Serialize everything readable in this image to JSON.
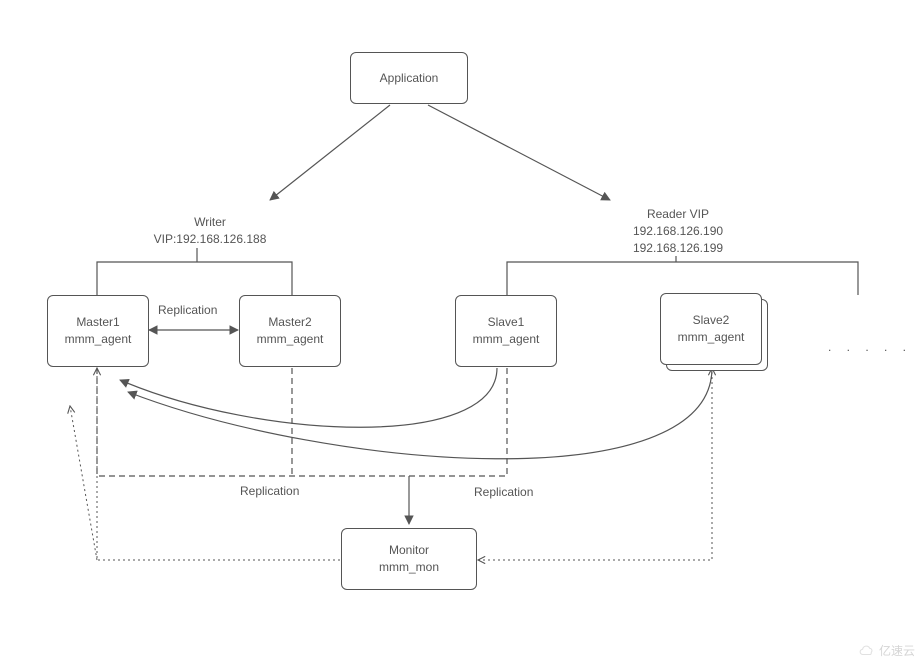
{
  "nodes": {
    "application": {
      "title": "Application"
    },
    "master1": {
      "title": "Master1",
      "subtitle": "mmm_agent"
    },
    "master2": {
      "title": "Master2",
      "subtitle": "mmm_agent"
    },
    "slave1": {
      "title": "Slave1",
      "subtitle": "mmm_agent"
    },
    "slave2": {
      "title": "Slave2",
      "subtitle": "mmm_agent"
    },
    "monitor": {
      "title": "Monitor",
      "subtitle": "mmm_mon"
    }
  },
  "labels": {
    "writer": {
      "line1": "Writer",
      "line2": "VIP:192.168.126.188"
    },
    "reader": {
      "line1": "Reader VIP",
      "line2": "192.168.126.190",
      "line3": "192.168.126.199"
    },
    "replication_masters": "Replication",
    "replication_left": "Replication",
    "replication_right": "Replication",
    "ellipsis": ". . . . ."
  },
  "watermark": {
    "text": "亿速云"
  }
}
